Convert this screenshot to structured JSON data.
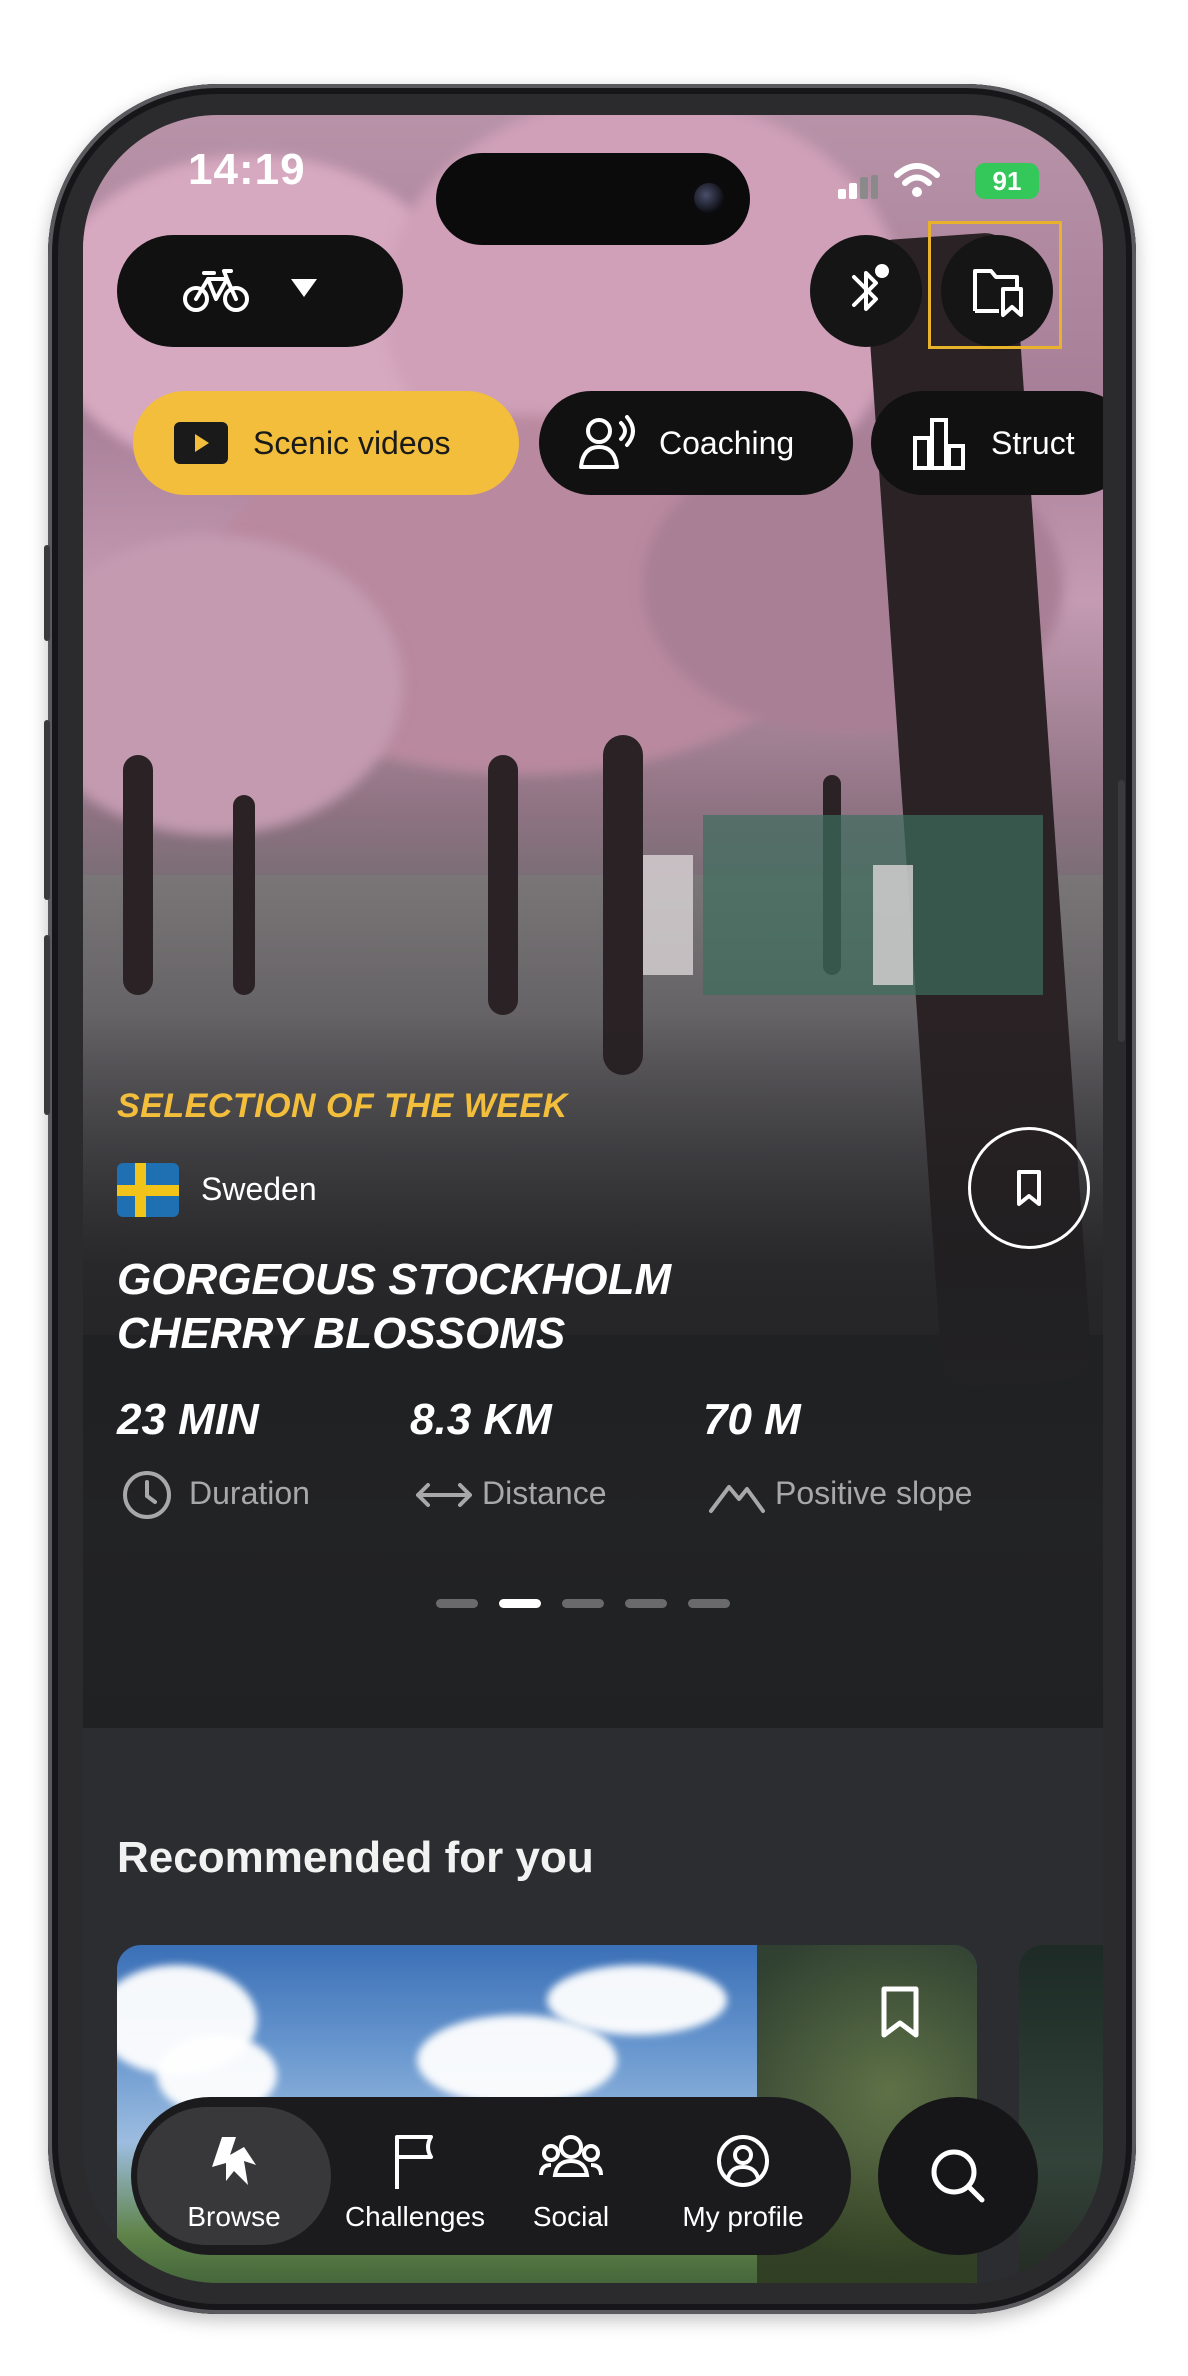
{
  "status_bar": {
    "time": "14:19",
    "battery": "91"
  },
  "top_bar": {
    "bike_selector_icon": "bicycle-icon",
    "bluetooth_icon": "bluetooth-icon",
    "library_icon": "folder-bookmark-icon"
  },
  "categories": [
    {
      "label": "Scenic videos",
      "icon": "play-icon",
      "active": true
    },
    {
      "label": "Coaching",
      "icon": "coach-icon",
      "active": false
    },
    {
      "label": "Struct",
      "icon": "bar-chart-icon",
      "active": false
    }
  ],
  "featured": {
    "kicker": "SELECTION OF THE WEEK",
    "country": "Sweden",
    "title_line1": "GORGEOUS STOCKHOLM",
    "title_line2": "CHERRY BLOSSOMS",
    "stats": [
      {
        "value": "23 MIN",
        "label": "Duration",
        "icon": "clock-icon"
      },
      {
        "value": "8.3 KM",
        "label": "Distance",
        "icon": "arrows-horizontal-icon"
      },
      {
        "value": "70 M",
        "label": "Positive slope",
        "icon": "mountain-icon"
      }
    ],
    "carousel": {
      "count": 5,
      "active_index": 1
    }
  },
  "recommended": {
    "title": "Recommended for you"
  },
  "tab_bar": {
    "browse": "Browse",
    "challenges": "Challenges",
    "social": "Social",
    "profile": "My profile"
  },
  "colors": {
    "accent": "#f2be3c",
    "background": "#2c2d30",
    "pill": "#111112"
  }
}
